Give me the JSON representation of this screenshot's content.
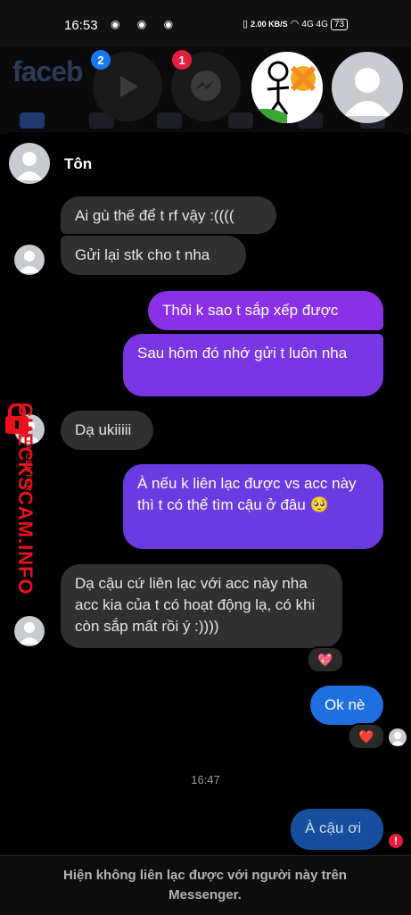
{
  "status_bar": {
    "time": "16:53",
    "left_icons": "◉ ◉ ◉",
    "network_speed": "2.00 KB/S",
    "signal": "4G 4G",
    "battery": "73"
  },
  "facebook_bg": {
    "logo": "faceb",
    "nav_badge": "1"
  },
  "chat_heads": {
    "video_badge": "2",
    "messenger_badge": "1"
  },
  "chat": {
    "contact_name": "Tôn",
    "messages": [
      {
        "dir": "in",
        "text": "Ai gù thế để t rf vậy :(((("
      },
      {
        "dir": "in",
        "text": "Gửi lại stk cho t nha"
      },
      {
        "dir": "out",
        "text": "Thôi k sao t sắp xếp được"
      },
      {
        "dir": "out",
        "text": "Sau hôm đó nhớ gửi t luôn nha"
      },
      {
        "dir": "in",
        "text": "Dạ ukiiiii"
      },
      {
        "dir": "out",
        "text": "À nếu k liên lạc được vs acc này thì t có thể tìm cậu ở đâu 🥺"
      },
      {
        "dir": "in",
        "text": "Dạ cậu cứ liên lạc với acc này nha acc kia của t có hoạt động lạ, có khi còn sắp mất rồi ý :))))"
      },
      {
        "dir": "out",
        "text": "Ok nè"
      },
      {
        "dir": "out",
        "text": "À cậu ơi"
      }
    ],
    "reaction_heart_sparkle": "💖",
    "reaction_heart": "❤️",
    "timestamp": "16:47",
    "error_mark": "!"
  },
  "footer": {
    "notice": "Hiện không liên lạc được với người này trên Messenger."
  },
  "watermark": {
    "main": "CHECKSCAM.INFO",
    "sub": "DATA CENTER"
  },
  "colors": {
    "sent_gradient_top": "#8e2de2",
    "sent_gradient_bottom": "#5b3fe0",
    "sent_blue": "#1f6fe0",
    "received": "#303030",
    "watermark_red": "#e8121c"
  }
}
